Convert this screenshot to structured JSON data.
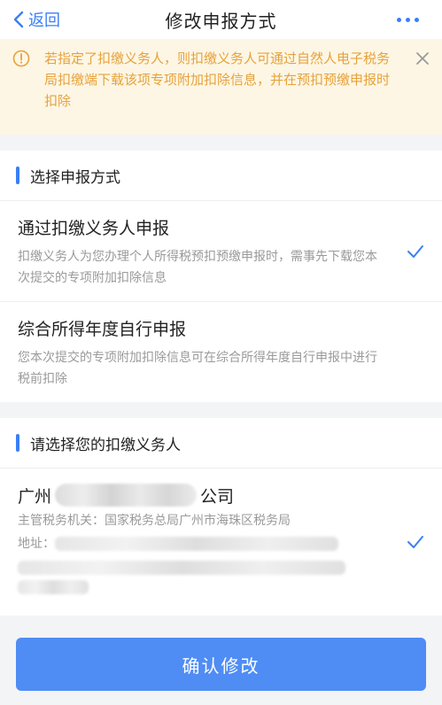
{
  "header": {
    "back_label": "返回",
    "title": "修改申报方式"
  },
  "notice": {
    "text": "若指定了扣缴义务人，则扣缴义务人可通过自然人电子税务局扣缴端下载该项专项附加扣除信息，并在预扣预缴申报时扣除"
  },
  "section1": {
    "title": "选择申报方式",
    "options": [
      {
        "title": "通过扣缴义务人申报",
        "desc": "扣缴义务人为您办理个人所得税预扣预缴申报时，需事先下载您本次提交的专项附加扣除信息",
        "selected": true
      },
      {
        "title": "综合所得年度自行申报",
        "desc": "您本次提交的专项附加扣除信息可在综合所得年度自行申报中进行税前扣除",
        "selected": false
      }
    ]
  },
  "section2": {
    "title": "请选择您的扣缴义务人",
    "agent": {
      "name_prefix": "广州",
      "name_suffix": "公司",
      "tax_authority": "主管税务机关：国家税务总局广州市海珠区税务局",
      "address_label": "地址：",
      "selected": true
    }
  },
  "confirm_label": "确认修改",
  "colors": {
    "accent": "#3b7ff5",
    "button": "#4f8df5",
    "notice_bg": "#fdf6e4",
    "notice_text": "#e6a23c"
  },
  "icons": {
    "back": "chevron-left-icon",
    "more": "more-dots-icon",
    "warning": "warning-circle-icon",
    "close": "close-icon",
    "check": "check-icon"
  }
}
